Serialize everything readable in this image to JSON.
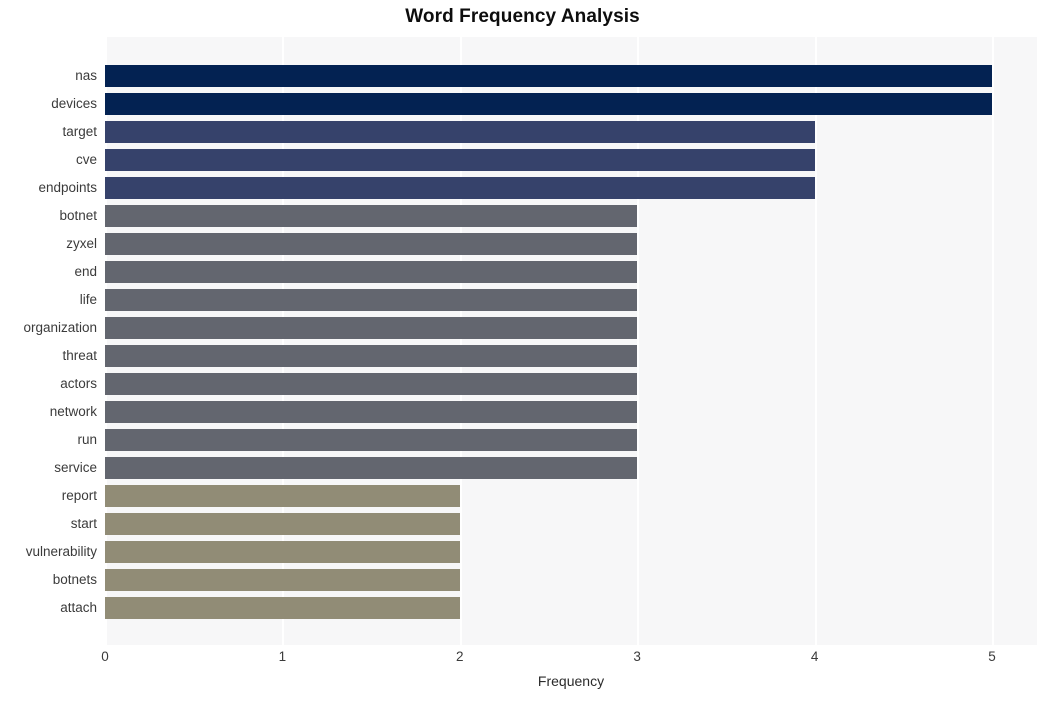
{
  "chart_data": {
    "type": "bar",
    "orientation": "horizontal",
    "title": "Word Frequency Analysis",
    "xlabel": "Frequency",
    "ylabel": "",
    "xlim": [
      0,
      5
    ],
    "xticks": [
      "0",
      "1",
      "2",
      "3",
      "4",
      "5"
    ],
    "grid": "vertical-white",
    "legend": "none",
    "categories": [
      "nas",
      "devices",
      "target",
      "cve",
      "endpoints",
      "botnet",
      "zyxel",
      "end",
      "life",
      "organization",
      "threat",
      "actors",
      "network",
      "run",
      "service",
      "report",
      "start",
      "vulnerability",
      "botnets",
      "attach"
    ],
    "values": [
      5,
      5,
      4,
      4,
      4,
      3,
      3,
      3,
      3,
      3,
      3,
      3,
      3,
      3,
      3,
      2,
      2,
      2,
      2,
      2
    ],
    "bar_colors": [
      "#032252",
      "#032252",
      "#36426b",
      "#36426b",
      "#36426b",
      "#63666f",
      "#63666f",
      "#63666f",
      "#63666f",
      "#63666f",
      "#63666f",
      "#63666f",
      "#63666f",
      "#63666f",
      "#63666f",
      "#918c76",
      "#918c76",
      "#918c76",
      "#918c76",
      "#918c76"
    ]
  },
  "colors": {
    "plot_background": "#f7f7f8",
    "figure_background": "#ffffff",
    "gridline": "#ffffff",
    "title_text": "#0d0d0d",
    "tick_text": "#3b3b3b",
    "tier_5": "#032252",
    "tier_4": "#36426b",
    "tier_3": "#63666f",
    "tier_2": "#918c76"
  }
}
